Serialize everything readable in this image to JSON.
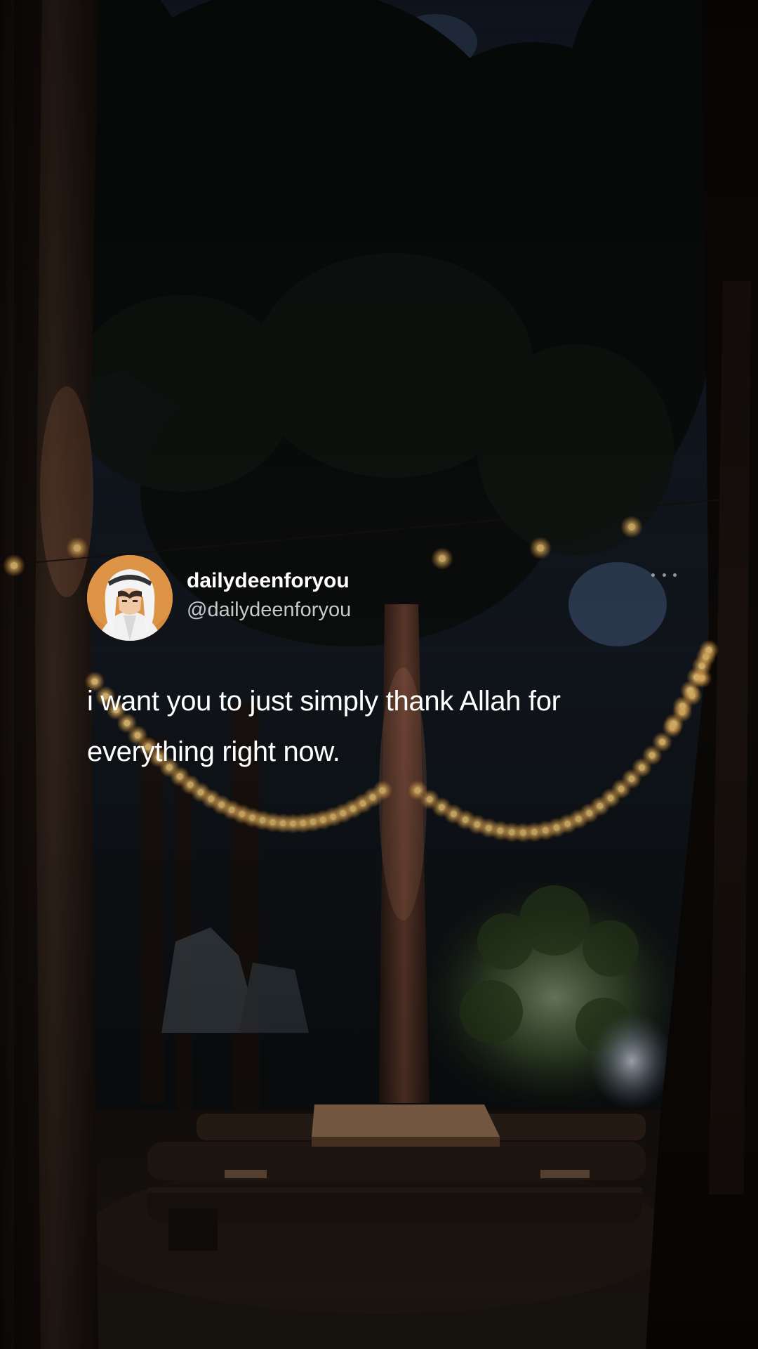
{
  "post": {
    "display_name": "dailydeenforyou",
    "handle": "@dailydeenforyou",
    "text": "i want you to just simply thank Allah for everything right now.",
    "avatar_icon": "profile-avatar-icon",
    "more_icon": "more-options-icon"
  },
  "colors": {
    "text": "#ffffff",
    "handle": "#c7c9cc",
    "light_bulbs": "#ffd27a",
    "avatar_bg": "#d58a3e"
  }
}
